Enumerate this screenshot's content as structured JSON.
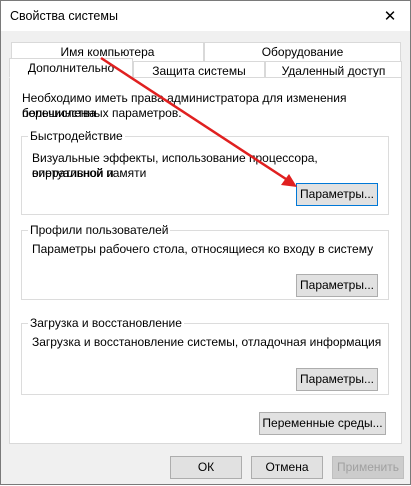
{
  "window": {
    "title": "Свойства системы",
    "close_glyph": "✕"
  },
  "tabs": {
    "row1": [
      "Имя компьютера",
      "Оборудование"
    ],
    "row2": [
      "Дополнительно",
      "Защита системы",
      "Удаленный доступ"
    ],
    "active": "Дополнительно"
  },
  "panel": {
    "admin_note_line1": "Необходимо иметь права администратора для изменения большинства",
    "admin_note_line2": "перечисленных параметров.",
    "performance": {
      "title": "Быстродействие",
      "desc_line1": "Визуальные эффекты, использование процессора, оперативной и",
      "desc_line2": "виртуальной памяти",
      "button": "Параметры..."
    },
    "user_profiles": {
      "title": "Профили пользователей",
      "desc": "Параметры рабочего стола, относящиеся ко входу в систему",
      "button": "Параметры..."
    },
    "startup_recovery": {
      "title": "Загрузка и восстановление",
      "desc": "Загрузка и восстановление системы, отладочная информация",
      "button": "Параметры..."
    },
    "env_button": "Переменные среды..."
  },
  "footer": {
    "ok": "ОК",
    "cancel": "Отмена",
    "apply": "Применить"
  },
  "colors": {
    "arrow": "#e02020",
    "focus_border": "#0078d7"
  }
}
